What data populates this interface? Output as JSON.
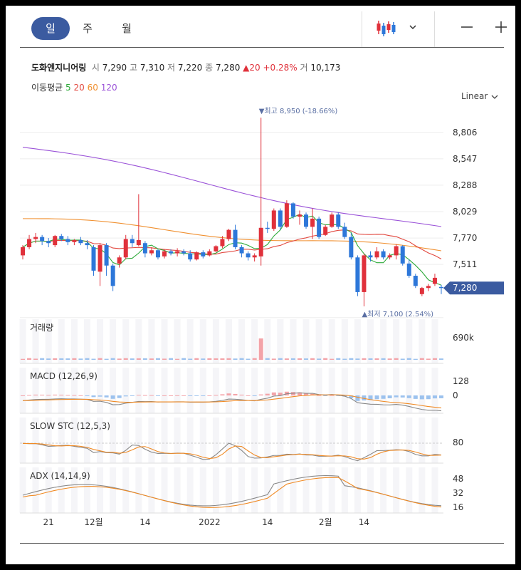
{
  "period_tabs": [
    {
      "label": "일",
      "active": true
    },
    {
      "label": "주",
      "active": false
    },
    {
      "label": "월",
      "active": false
    }
  ],
  "stock": {
    "name": "도화엔지니어링",
    "open_label": "시",
    "open": "7,290",
    "high_label": "고",
    "high": "7,310",
    "low_label": "저",
    "low": "7,220",
    "close_label": "종",
    "close": "7,280",
    "change": "▲20",
    "change_pct": "+0.28%",
    "volume_label": "거",
    "volume": "10,173"
  },
  "moving_average": {
    "label": "이동평균",
    "periods": [
      "5",
      "20",
      "60",
      "120"
    ],
    "colors": [
      "#2eaa3a",
      "#e2483f",
      "#f09030",
      "#9a52d8"
    ]
  },
  "scale_label": "Linear",
  "colors": {
    "up": "#e0313b",
    "down": "#2d77d9",
    "accent": "#3b5ba0"
  },
  "chart_data": {
    "type": "candlestick",
    "price_ticks": [
      "8,806",
      "8,547",
      "8,288",
      "8,029",
      "7,770",
      "7,511"
    ],
    "price_tick_values": [
      8806,
      8547,
      8288,
      8029,
      7770,
      7511
    ],
    "ylim": [
      7030,
      9000
    ],
    "current_price_label": "7,280",
    "current_price": 7280,
    "max_annotation": "▼최고 8,950 (-18.66%)",
    "min_annotation": "▲최저 7,100 (2.54%)",
    "x_tick_labels": [
      {
        "label": "21",
        "idx": 4
      },
      {
        "label": "12월",
        "idx": 11
      },
      {
        "label": "14",
        "idx": 19
      },
      {
        "label": "2022",
        "idx": 29
      },
      {
        "label": "14",
        "idx": 38
      },
      {
        "label": "2월",
        "idx": 47
      },
      {
        "label": "14",
        "idx": 53
      }
    ],
    "candles": [
      [
        7600,
        7700,
        7560,
        7680
      ],
      [
        7680,
        7800,
        7660,
        7760
      ],
      [
        7760,
        7820,
        7720,
        7780
      ],
      [
        7780,
        7800,
        7700,
        7740
      ],
      [
        7740,
        7770,
        7680,
        7720
      ],
      [
        7700,
        7800,
        7680,
        7790
      ],
      [
        7790,
        7810,
        7740,
        7760
      ],
      [
        7760,
        7790,
        7700,
        7730
      ],
      [
        7730,
        7760,
        7700,
        7750
      ],
      [
        7750,
        7780,
        7700,
        7720
      ],
      [
        7720,
        7750,
        7660,
        7700
      ],
      [
        7680,
        7700,
        7400,
        7450
      ],
      [
        7440,
        7720,
        7300,
        7700
      ],
      [
        7700,
        7720,
        7400,
        7500
      ],
      [
        7500,
        7520,
        7250,
        7300
      ],
      [
        7520,
        7600,
        7480,
        7580
      ],
      [
        7580,
        7800,
        7560,
        7760
      ],
      [
        7760,
        7800,
        7680,
        7720
      ],
      [
        7700,
        8200,
        7690,
        7750
      ],
      [
        7720,
        7740,
        7580,
        7620
      ],
      [
        7620,
        7680,
        7600,
        7650
      ],
      [
        7650,
        7660,
        7560,
        7580
      ],
      [
        7590,
        7660,
        7570,
        7640
      ],
      [
        7640,
        7660,
        7600,
        7620
      ],
      [
        7620,
        7670,
        7590,
        7640
      ],
      [
        7640,
        7660,
        7600,
        7620
      ],
      [
        7620,
        7650,
        7540,
        7560
      ],
      [
        7560,
        7640,
        7550,
        7630
      ],
      [
        7630,
        7650,
        7570,
        7590
      ],
      [
        7600,
        7660,
        7590,
        7640
      ],
      [
        7640,
        7700,
        7630,
        7690
      ],
      [
        7690,
        7790,
        7670,
        7760
      ],
      [
        7760,
        7860,
        7740,
        7850
      ],
      [
        7850,
        7900,
        7660,
        7680
      ],
      [
        7680,
        7700,
        7580,
        7620
      ],
      [
        7620,
        7640,
        7550,
        7580
      ],
      [
        7580,
        7620,
        7540,
        7600
      ],
      [
        7590,
        8950,
        7500,
        7870
      ],
      [
        7870,
        7930,
        7820,
        7860
      ],
      [
        7860,
        8060,
        7840,
        8040
      ],
      [
        8040,
        8060,
        7850,
        7880
      ],
      [
        7880,
        8140,
        7870,
        8110
      ],
      [
        8110,
        8120,
        7960,
        7980
      ],
      [
        7980,
        8040,
        7900,
        8000
      ],
      [
        8000,
        8020,
        7860,
        7880
      ],
      [
        7880,
        8060,
        7760,
        7960
      ],
      [
        7960,
        7980,
        7760,
        7780
      ],
      [
        7800,
        7900,
        7790,
        7880
      ],
      [
        7880,
        8020,
        7870,
        8000
      ],
      [
        8000,
        8020,
        7860,
        7880
      ],
      [
        7880,
        7920,
        7760,
        7780
      ],
      [
        7780,
        7820,
        7560,
        7580
      ],
      [
        7580,
        7600,
        7200,
        7240
      ],
      [
        7240,
        7620,
        7100,
        7600
      ],
      [
        7600,
        7640,
        7540,
        7580
      ],
      [
        7580,
        7680,
        7560,
        7640
      ],
      [
        7640,
        7660,
        7560,
        7580
      ],
      [
        7580,
        7620,
        7560,
        7600
      ],
      [
        7600,
        7710,
        7560,
        7690
      ],
      [
        7690,
        7700,
        7500,
        7520
      ],
      [
        7520,
        7560,
        7380,
        7400
      ],
      [
        7400,
        7420,
        7280,
        7300
      ],
      [
        7220,
        7290,
        7200,
        7280
      ],
      [
        7280,
        7320,
        7250,
        7300
      ],
      [
        7320,
        7420,
        7300,
        7380
      ],
      [
        7290,
        7310,
        7220,
        7280
      ]
    ],
    "ma120": [
      8660,
      7850
    ],
    "ma60": [
      7960,
      7640
    ],
    "volume_label": "거래량",
    "volume_tick": "690k",
    "macd_label": "MACD (12,26,9)",
    "macd_ticks": [
      "128",
      "0"
    ],
    "stoch_label": "SLOW STC (12,5,3)",
    "stoch_ticks": [
      "80"
    ],
    "adx_label": "ADX (14,14,9)",
    "adx_ticks": [
      "48",
      "32",
      "16"
    ]
  }
}
